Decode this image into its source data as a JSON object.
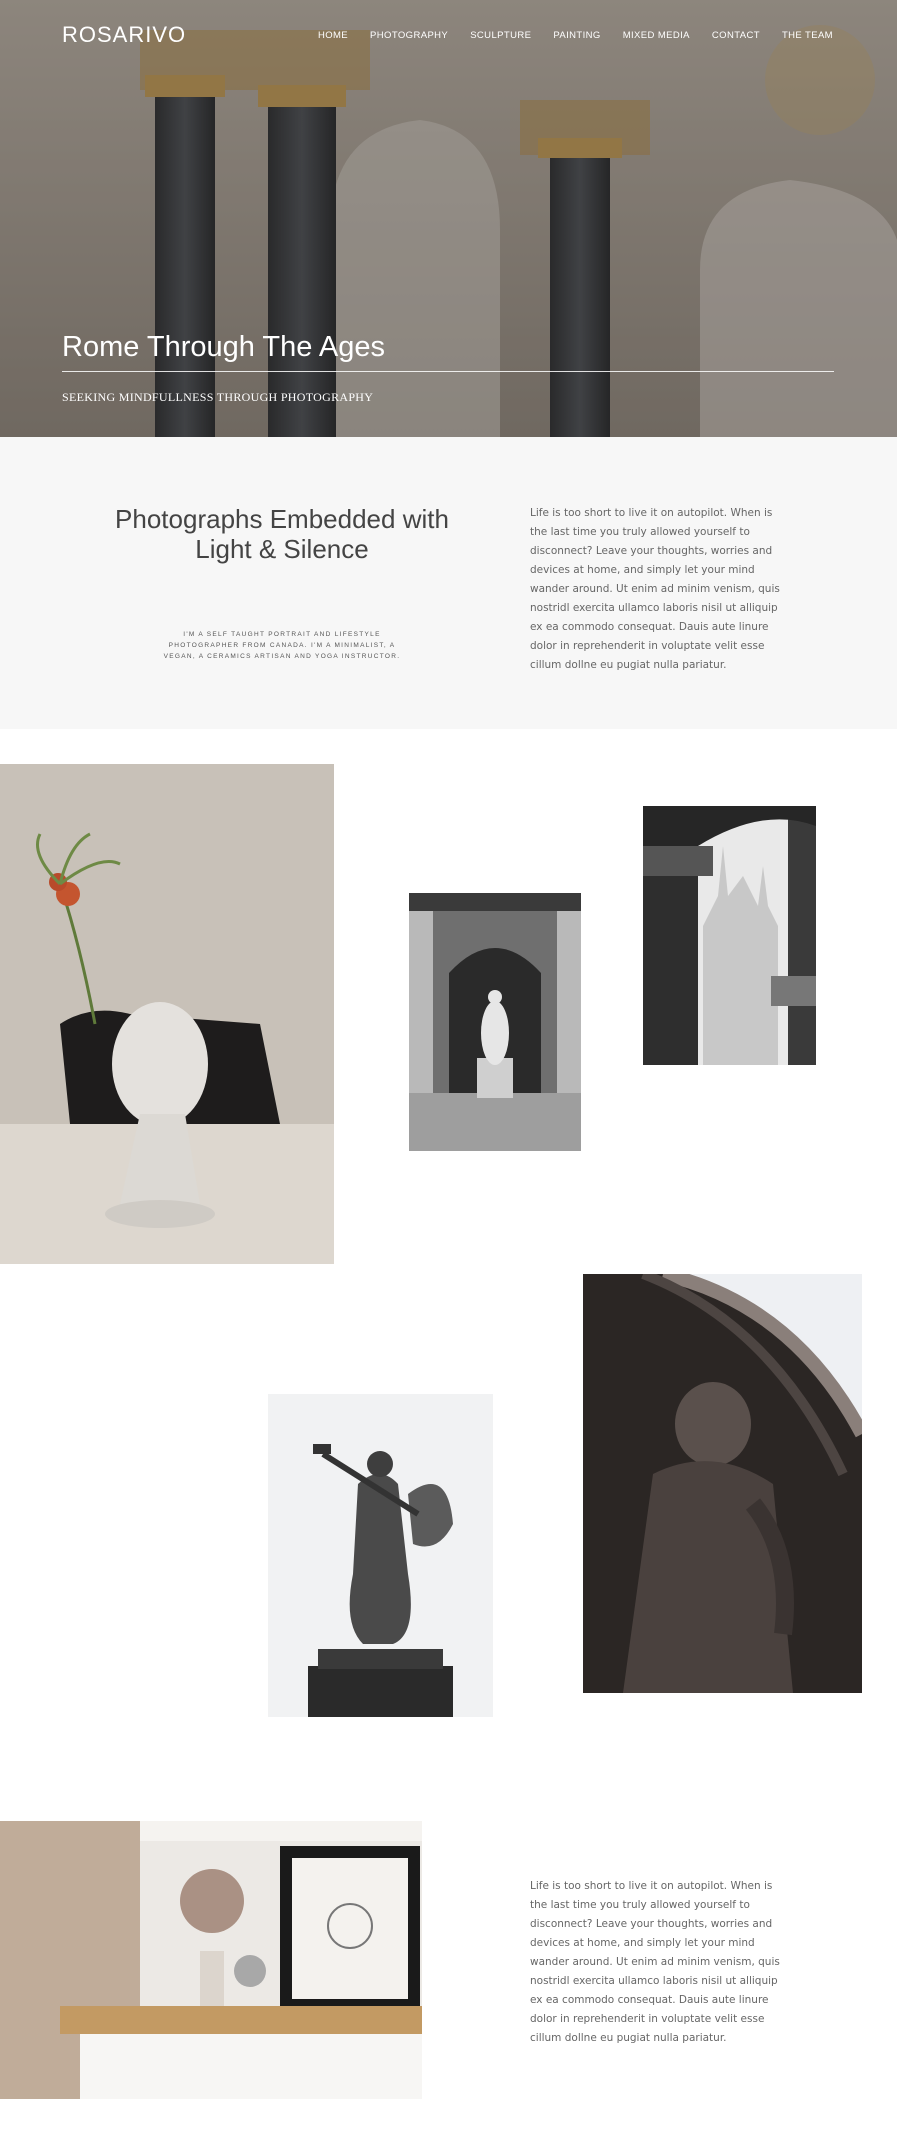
{
  "brand": "ROSARIVO",
  "nav": [
    "HOME",
    "PHOTOGRAPHY",
    "SCULPTURE",
    "PAINTING",
    "MIXED MEDIA",
    "CONTACT",
    "THE TEAM"
  ],
  "hero": {
    "title": "Rome Through The Ages",
    "subtitle": "SEEKING MINDFULLNESS THROUGH PHOTOGRAPHY"
  },
  "intro": {
    "heading": "Photographs Embedded with Light & Silence",
    "small": "I'M A SELF TAUGHT PORTRAIT AND LIFESTYLE PHOTOGRAPHER FROM CANADA. I'M A MINIMALIST, A VEGAN, A CERAMICS ARTISAN AND YOGA INSTRUCTOR.",
    "body": "Life is too short to live it on autopilot. When is the last time you truly allowed yourself to disconnect? Leave your thoughts, worries and devices at home, and simply let your mind wander around. Ut enim ad minim venism, quis nostridl exercita ullamco laboris nisil ut alliquip ex ea commodo consequat. Dauis aute linure dolor in reprehenderit in voluptate velit esse cillum dollne eu pugiat nulla pariatur."
  },
  "bottom": {
    "body": "Life is too short to live it on autopilot. When is the last time you truly allowed yourself to disconnect? Leave your thoughts, worries and devices at home, and simply let your mind wander around. Ut enim ad minim venism, quis nostridl exercita ullamco laboris nisil ut alliquip ex ea commodo consequat. Dauis aute linure dolor in reprehenderit in voluptate velit esse cillum dollne eu pugiat nulla pariatur."
  },
  "colors": {
    "hero_overlay": "#3a342f",
    "intro_bg": "#f7f7f7",
    "text": "#666666",
    "heading": "#444444"
  }
}
